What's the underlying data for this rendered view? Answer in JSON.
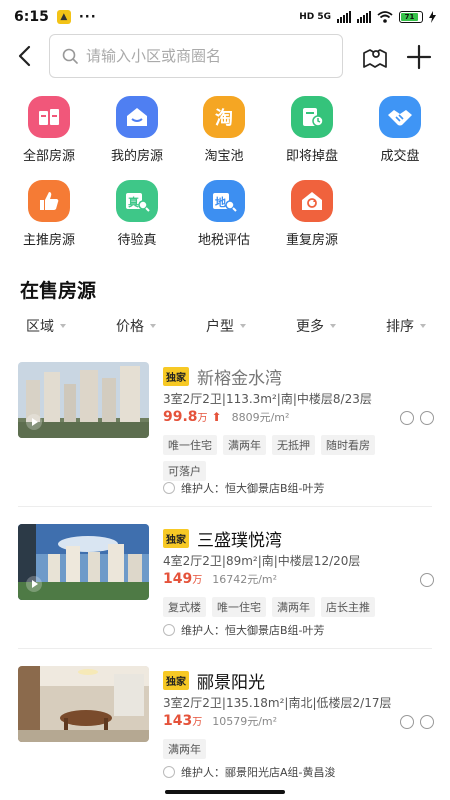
{
  "status": {
    "time": "6:15",
    "dots": "···",
    "network": "HD 5G",
    "battery": "71"
  },
  "search": {
    "placeholder": "请输入小区或商圈名"
  },
  "functions": [
    {
      "label": "全部房源",
      "icon": "all-listings-icon",
      "color": "#f1577a"
    },
    {
      "label": "我的房源",
      "icon": "my-listings-icon",
      "color": "#4f7ff2"
    },
    {
      "label": "淘宝池",
      "icon": "taobao-pool-icon",
      "color": "#f5a623"
    },
    {
      "label": "即将掉盘",
      "icon": "expiring-listings-icon",
      "color": "#35c37b"
    },
    {
      "label": "成交盘",
      "icon": "handshake-icon",
      "color": "#3f95f5"
    },
    {
      "label": "主推房源",
      "icon": "thumbs-up-icon",
      "color": "#f57b35"
    },
    {
      "label": "待验真",
      "icon": "verify-icon",
      "color": "#3ec788"
    },
    {
      "label": "地税评估",
      "icon": "tax-assessment-icon",
      "color": "#3d8ff1"
    },
    {
      "label": "重复房源",
      "icon": "duplicate-icon",
      "color": "#f0623d"
    }
  ],
  "section_title": "在售房源",
  "filters": [
    "区域",
    "价格",
    "户型",
    "更多",
    "排序"
  ],
  "listings": [
    {
      "badge": "独家",
      "name": "新榕金水湾",
      "spec": "3室2厅2卫|113.3m²|南|中楼层8/23层",
      "price": "99.8",
      "price_unit": "万",
      "price_trend": "up",
      "unit_price": "8809元/m²",
      "tags": [
        "唯一住宅",
        "满两年",
        "无抵押",
        "随时看房",
        "可落户"
      ],
      "keeper_label": "维护人：",
      "keeper": "恒大御景店B组-叶芳"
    },
    {
      "badge": "独家",
      "name": "三盛璞悦湾",
      "spec": "4室2厅2卫|89m²|南|中楼层12/20层",
      "price": "149",
      "price_unit": "万",
      "unit_price": "16742元/m²",
      "tags": [
        "复式楼",
        "唯一住宅",
        "满两年",
        "店长主推"
      ],
      "keeper_label": "维护人：",
      "keeper": "恒大御景店B组-叶芳"
    },
    {
      "badge": "独家",
      "name": "郦景阳光",
      "spec": "3室2厅2卫|135.18m²|南北|低楼层2/17层",
      "price": "143",
      "price_unit": "万",
      "unit_price": "10579元/m²",
      "tags": [
        "满两年"
      ],
      "keeper_label": "维护人：",
      "keeper": "郦景阳光店A组-黄昌浚"
    }
  ]
}
